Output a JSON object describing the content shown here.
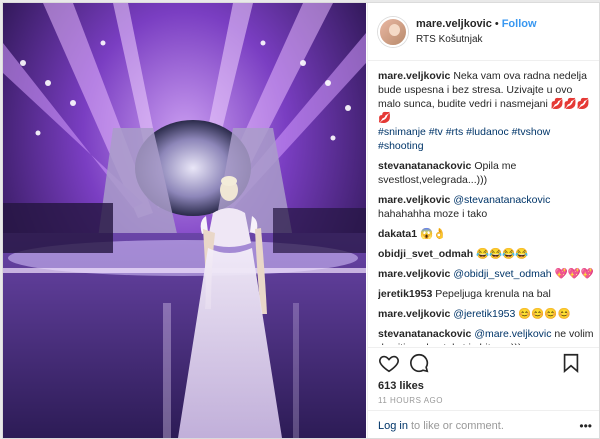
{
  "header": {
    "username": "mare.veljkovic",
    "separator": "•",
    "follow_label": "Follow",
    "location": "RTS Košutnjak"
  },
  "caption": {
    "username": "mare.veljkovic",
    "text": "Neka vam ova radna nedelja bude uspesna i bez stresa. Uzivajte u ovo malo sunca, budite vedri i nasmejani",
    "hashtags": "#snimanje #tv #rts #ludanoc #tvshow #shooting"
  },
  "comments": [
    {
      "username": "stevanatanackovic",
      "text": "Opila me svestlost,velegrada...)))"
    },
    {
      "username": "mare.veljkovic",
      "mention": "@stevanatanackovic",
      "text": "hahahahha moze i tako"
    },
    {
      "username": "dakata1",
      "text": ""
    },
    {
      "username": "obidji_svet_odmah",
      "text": ""
    },
    {
      "username": "mare.veljkovic",
      "mention": "@obidji_svet_odmah",
      "text": ""
    },
    {
      "username": "jeretik1953",
      "text": "Pepeljuga krenula na bal"
    },
    {
      "username": "mare.veljkovic",
      "mention": "@jeretik1953",
      "text": ""
    },
    {
      "username": "stevanatanackovic",
      "mention": "@mare.veljkovic",
      "text": "ne volim da citiram,kontekst je bitan...)))"
    }
  ],
  "actions": {
    "likes": "613 likes",
    "time": "11 HOURS AGO",
    "login_link": "Log in",
    "login_text": "to like or comment.",
    "more": "•••"
  },
  "colors": {
    "accent": "#3897f0",
    "link": "#003569",
    "muted": "#999999"
  },
  "icons": [
    "heart-icon",
    "comment-icon",
    "bookmark-icon"
  ]
}
